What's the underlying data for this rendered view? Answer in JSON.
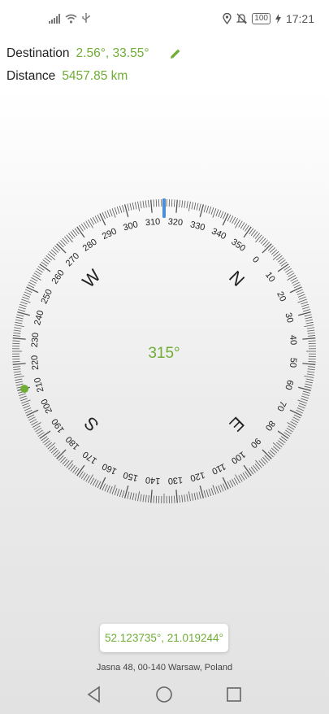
{
  "status_bar": {
    "time": "17:21",
    "battery": "100",
    "icons": [
      "signal-icon",
      "wifi-icon",
      "usb-icon",
      "location-icon",
      "mute-icon",
      "battery-icon",
      "charging-icon"
    ]
  },
  "destination": {
    "label": "Destination",
    "value": "2.56°, 33.55°"
  },
  "distance": {
    "label": "Distance",
    "value": "5457.85 km"
  },
  "compass": {
    "heading_label": "315°",
    "heading_deg": 315,
    "target_bearing_deg": 210,
    "cardinals": [
      "N",
      "E",
      "S",
      "W"
    ],
    "degree_labels": [
      "0",
      "10",
      "20",
      "30",
      "40",
      "50",
      "60",
      "70",
      "80",
      "90",
      "100",
      "110",
      "120",
      "130",
      "140",
      "150",
      "160",
      "170",
      "180",
      "190",
      "200",
      "210",
      "220",
      "230",
      "240",
      "250",
      "260",
      "270",
      "280",
      "290",
      "300",
      "310",
      "320",
      "330",
      "340",
      "350"
    ]
  },
  "location": {
    "coordinates": "52.123735°, 21.019244°",
    "address": "Jasna 48, 00-140 Warsaw, Poland"
  },
  "colors": {
    "accent": "#6fad35",
    "indicator": "#4a8fd6"
  }
}
